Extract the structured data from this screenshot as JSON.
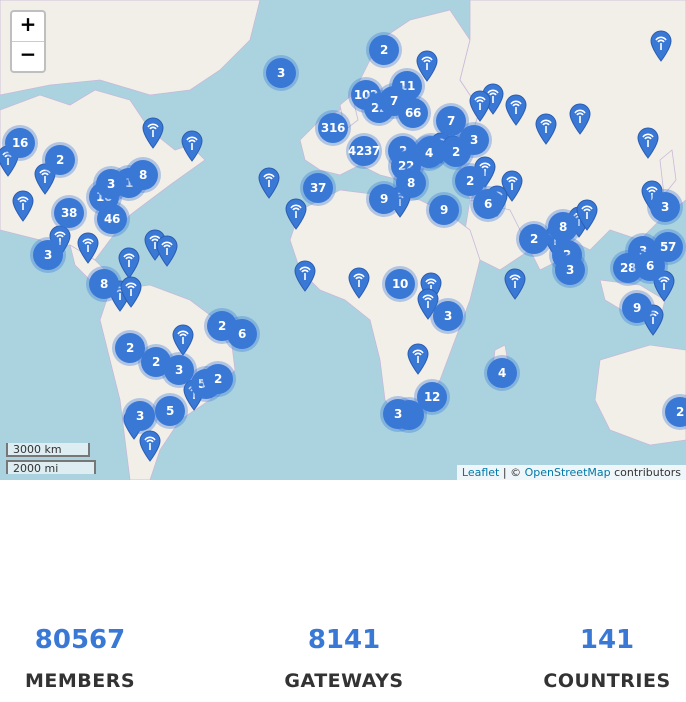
{
  "map": {
    "zoom_in": "+",
    "zoom_out": "−",
    "scale_km": "3000 km",
    "scale_mi": "2000 mi",
    "attribution": {
      "leaflet": "Leaflet",
      "sep": " | © ",
      "osm": "OpenStreetMap",
      "suffix": " contributors"
    },
    "clusters": [
      "2",
      "3",
      "102",
      "11",
      "22",
      "7",
      "66",
      "316",
      "7",
      "16",
      "2",
      "4237",
      "2",
      "22",
      "4",
      "2",
      "3",
      "116",
      "8",
      "16",
      "3",
      "46",
      "38",
      "3",
      "37",
      "9",
      "8",
      "9",
      "2",
      "6",
      "2",
      "3",
      "8",
      "3",
      "2",
      "3",
      "57",
      "28",
      "6",
      "8",
      "10",
      "3",
      "2",
      "6",
      "2",
      "2",
      "3",
      "50",
      "3",
      "5",
      "9",
      "4",
      "12",
      "3",
      "3",
      "2",
      "4",
      "2"
    ],
    "pin_icon": "gateway-pin-icon"
  },
  "stats": [
    {
      "value": "80567",
      "label": "MEMBERS"
    },
    {
      "value": "8141",
      "label": "GATEWAYS"
    },
    {
      "value": "141",
      "label": "COUNTRIES"
    }
  ],
  "colors": {
    "marker": "#3a78d6",
    "water": "#aad3df",
    "land": "#f2efe9"
  }
}
